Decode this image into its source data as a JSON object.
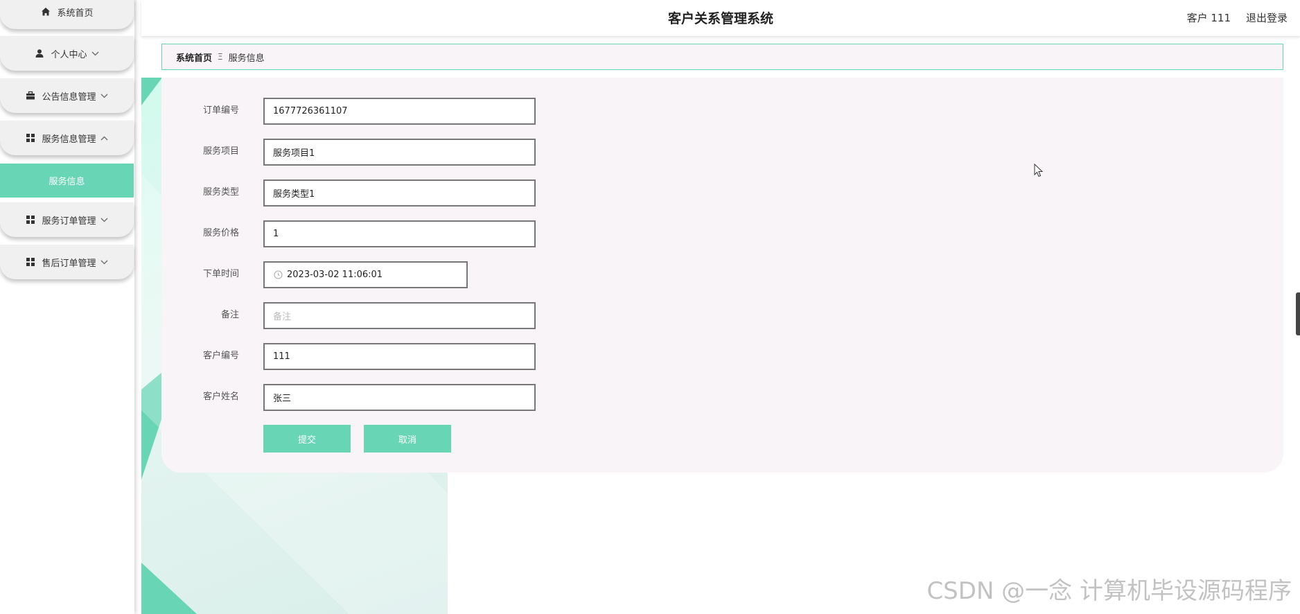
{
  "app": {
    "title": "客户关系管理系统",
    "user_label": "客户 111",
    "logout_label": "退出登录"
  },
  "sidebar": {
    "items": [
      {
        "label": "系统首页",
        "icon": "home-icon"
      },
      {
        "label": "个人中心",
        "icon": "user-icon"
      },
      {
        "label": "公告信息管理",
        "icon": "briefcase-icon"
      },
      {
        "label": "服务信息管理",
        "icon": "grid-icon"
      },
      {
        "label": "服务订单管理",
        "icon": "grid-icon"
      },
      {
        "label": "售后订单管理",
        "icon": "grid-icon"
      }
    ],
    "active_sub": "服务信息"
  },
  "breadcrumb": {
    "home": "系统首页",
    "separator": "Ξ",
    "current": "服务信息"
  },
  "form": {
    "order_no": {
      "label": "订单编号",
      "value": "1677726361107"
    },
    "service_item": {
      "label": "服务项目",
      "value": "服务项目1"
    },
    "service_type": {
      "label": "服务类型",
      "value": "服务类型1"
    },
    "service_price": {
      "label": "服务价格",
      "value": "1"
    },
    "order_time": {
      "label": "下单时间",
      "value": "2023-03-02 11:06:01"
    },
    "remark": {
      "label": "备注",
      "placeholder": "备注"
    },
    "customer_no": {
      "label": "客户编号",
      "value": "111"
    },
    "customer_name": {
      "label": "客户姓名",
      "value": "张三"
    },
    "submit_label": "提交",
    "cancel_label": "取消"
  },
  "watermark": "CSDN @一念 计算机毕设源码程序",
  "colors": {
    "accent": "#68d5b5",
    "card_bg": "#f8f4f7",
    "menu_bg": "#f0f0f0"
  }
}
